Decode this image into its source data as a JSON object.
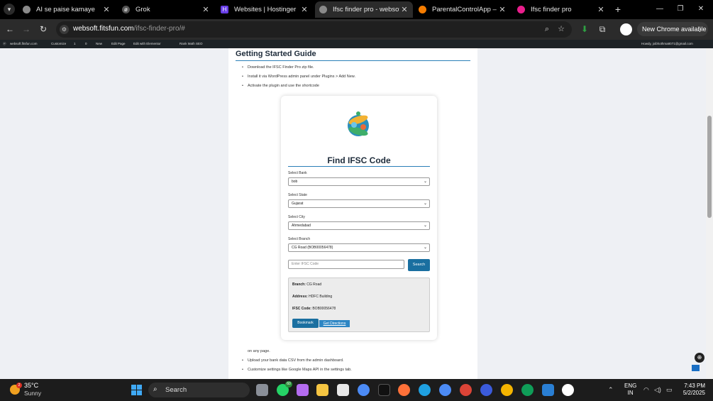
{
  "browser": {
    "tabs": [
      {
        "label": "AI se paise kamaye",
        "favicon": "globe-icon",
        "color": "#8a8a8a"
      },
      {
        "label": "Grok",
        "favicon": "grok-icon",
        "color": "#555555"
      },
      {
        "label": "Websites | Hostinger",
        "favicon": "hostinger-icon",
        "color": "#673de6"
      },
      {
        "label": "Ifsc finder pro - websoft.fi",
        "favicon": "globe-icon",
        "color": "#8a8a8a",
        "active": true
      },
      {
        "label": "ParentalControlApp – Ove",
        "favicon": "fire-icon",
        "color": "#f57c00"
      },
      {
        "label": "Ifsc finder pro",
        "favicon": "globe-icon",
        "color": "#e91e8c"
      }
    ],
    "url_host": "websoft.fitsfun.com",
    "url_path": "/ifsc-finder-pro/#",
    "new_chrome_label": "New Chrome available"
  },
  "adminbar": {
    "site": "websoft.fitsfun.com",
    "customize": "Customize",
    "updates": "1",
    "comments": "0",
    "new": "New",
    "edit_page": "Edit Page",
    "elementor": "Edit with Elementor",
    "rank_math": "Rank Math SEO",
    "howdy": "Howdy, jxibhothma8071@gmail.com"
  },
  "guide": {
    "title": "Getting Started Guide",
    "steps": [
      "Download the IFSC Finder Pro zip file.",
      "Install it via WordPress admin panel under Plugins > Add New.",
      "Activate the plugin and use the shortcode"
    ],
    "after_text": "on any page.",
    "more_steps": [
      "Upload your bank data CSV from the admin dashboard.",
      "Customize settings like Google Maps API in the settings tab."
    ]
  },
  "finder": {
    "title": "Find IFSC Code",
    "bank_label": "Select Bank",
    "bank_value": "bob",
    "state_label": "Select State",
    "state_value": "Gujarat",
    "city_label": "Select City",
    "city_value": "Ahmedabad",
    "branch_label": "Select Branch",
    "branch_value": "CG Road (BOB00056478)",
    "ifsc_placeholder": "Enter IFSC Code",
    "search_label": "Search",
    "result": {
      "branch_key": "Branch:",
      "branch_val": "CG Road",
      "address_key": "Address:",
      "address_val": "HDFC Building",
      "ifsc_key": "IFSC Code:",
      "ifsc_val": "BOB00056478"
    },
    "bookmark_label": "Bookmark",
    "directions_label": "Get Directions"
  },
  "taskbar": {
    "temp": "35°C",
    "condition": "Sunny",
    "weather_badge": "2",
    "search_label": "Search",
    "whatsapp_badge": "60",
    "lang_line1": "ENG",
    "lang_line2": "IN",
    "time": "7:43 PM",
    "date": "5/2/2025"
  }
}
